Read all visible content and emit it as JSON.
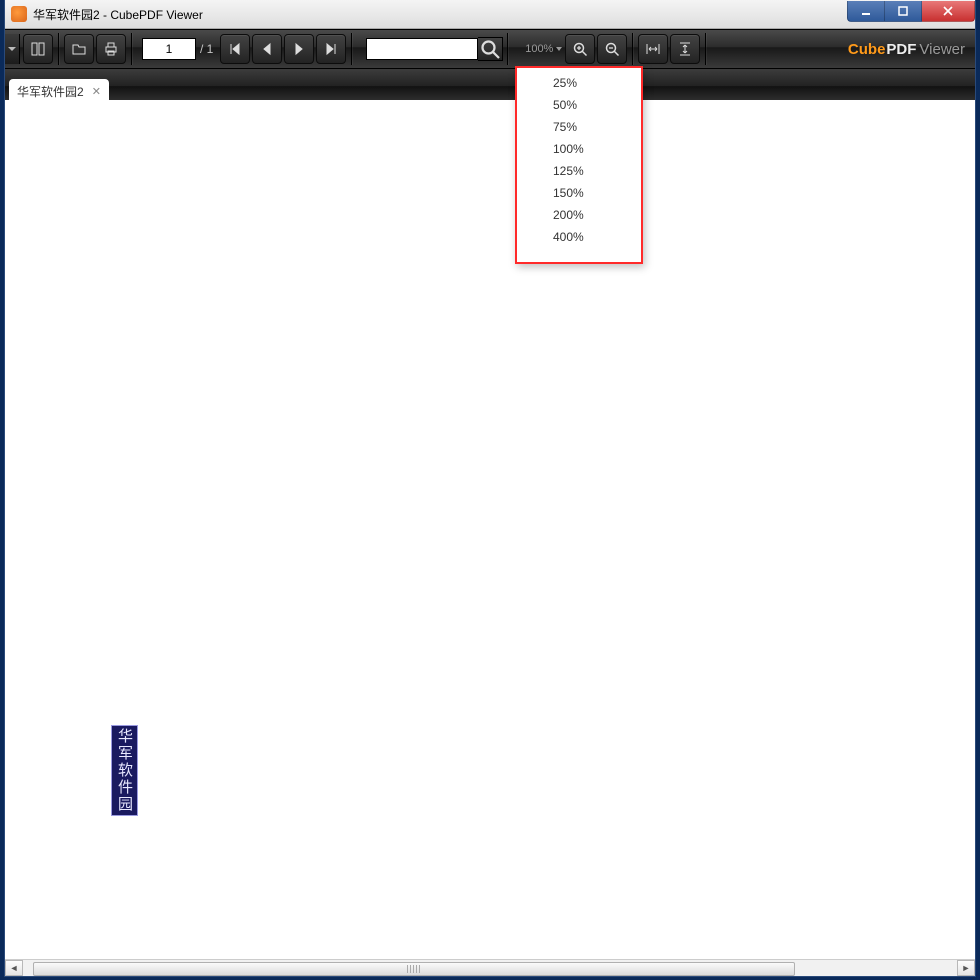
{
  "window": {
    "title": "华军软件园2 - CubePDF Viewer"
  },
  "tab": {
    "label": "华军软件园2"
  },
  "page": {
    "current": "1",
    "total_prefix": "/ 1"
  },
  "zoom": {
    "current": "100%",
    "options": [
      "25%",
      "50%",
      "75%",
      "100%",
      "125%",
      "150%",
      "200%",
      "400%"
    ]
  },
  "document": {
    "body_text": "华军软件园"
  },
  "logo": {
    "p1": "Cube",
    "p2": "PDF",
    "p3": "Viewer"
  }
}
